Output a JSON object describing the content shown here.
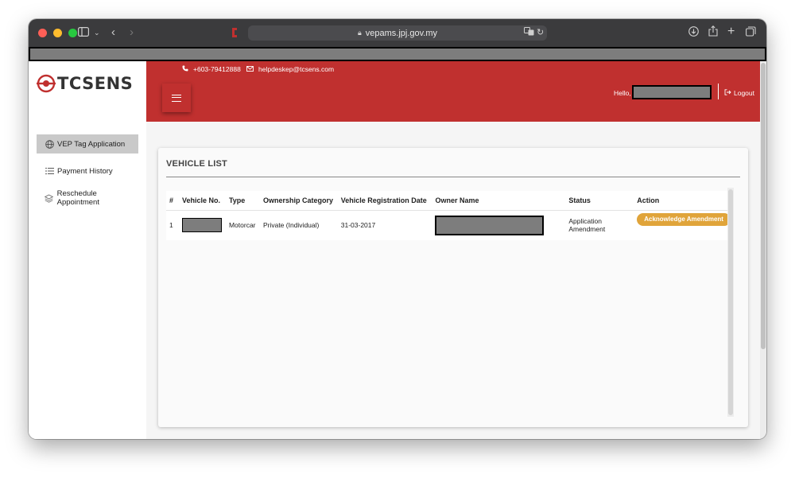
{
  "browser": {
    "url": "vepams.jpj.gov.my",
    "icons": [
      "sidebar-icon",
      "chevron-down-icon",
      "back-icon",
      "forward-icon",
      "lock-icon",
      "translate-icon",
      "reload-icon",
      "download-icon",
      "share-icon",
      "new-tab-icon",
      "tabs-icon"
    ]
  },
  "brand": {
    "name": "TCSENS",
    "accent_color": "#c0302f"
  },
  "header": {
    "phone": "+603-79412888",
    "email": "helpdeskep@tcsens.com",
    "greeting": "Hello,",
    "logout_label": "Logout"
  },
  "sidebar": {
    "items": [
      {
        "label": "VEP Tag Application",
        "active": true
      },
      {
        "label": "Payment History",
        "active": false
      },
      {
        "label": "Reschedule Appointment",
        "active": false
      }
    ]
  },
  "vehicle_list": {
    "title": "VEHICLE LIST",
    "columns": [
      "#",
      "Vehicle No.",
      "Type",
      "Ownership Category",
      "Vehicle Registration Date",
      "Owner Name",
      "Status",
      "Action"
    ],
    "rows": [
      {
        "index": "1",
        "type": "Motorcar",
        "ownership": "Private (Individual)",
        "registration_date": "31-03-2017",
        "status_line1": "Application",
        "status_line2": "Amendment",
        "action_label": "Acknowledge Amendment",
        "action_color": "#e0a43a"
      }
    ]
  }
}
